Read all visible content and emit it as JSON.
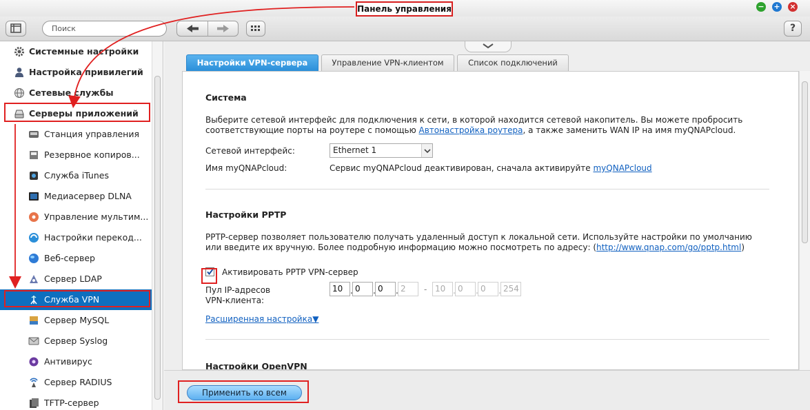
{
  "window": {
    "title_callout": "Панель управления",
    "colors": {
      "minimize": "#2ea22e",
      "maximize": "#1f78d1",
      "close": "#d23030",
      "accent": "#2b8fd9",
      "annotation": "#e02020"
    }
  },
  "toolbar": {
    "search_placeholder": "Поиск",
    "help_label": "?"
  },
  "sidebar": {
    "categories": [
      {
        "label": "Системные настройки",
        "icon": "gear-icon"
      },
      {
        "label": "Настройка привилегий",
        "icon": "user-icon"
      },
      {
        "label": "Сетевые службы",
        "icon": "globe-icon"
      },
      {
        "label": "Серверы приложений",
        "icon": "drive-icon"
      }
    ],
    "items": [
      {
        "label": "Станция управления",
        "icon": "station-icon"
      },
      {
        "label": "Резервное копиров...",
        "icon": "backup-icon"
      },
      {
        "label": "Служба iTunes",
        "icon": "itunes-icon"
      },
      {
        "label": "Медиасервер DLNA",
        "icon": "dlna-icon"
      },
      {
        "label": "Управление мультим...",
        "icon": "multimedia-icon"
      },
      {
        "label": "Настройки перекод...",
        "icon": "transcode-icon"
      },
      {
        "label": "Веб-сервер",
        "icon": "web-icon"
      },
      {
        "label": "Сервер LDAP",
        "icon": "ldap-icon"
      },
      {
        "label": "Служба VPN",
        "icon": "vpn-icon",
        "selected": true
      },
      {
        "label": "Сервер MySQL",
        "icon": "mysql-icon"
      },
      {
        "label": "Сервер Syslog",
        "icon": "syslog-icon"
      },
      {
        "label": "Антивирус",
        "icon": "antivirus-icon"
      },
      {
        "label": "Сервер RADIUS",
        "icon": "radius-icon"
      },
      {
        "label": "TFTP-сервер",
        "icon": "tftp-icon"
      }
    ]
  },
  "tabs": [
    {
      "label": "Настройки VPN-сервера",
      "active": true
    },
    {
      "label": "Управление VPN-клиентом",
      "active": false
    },
    {
      "label": "Список подключений",
      "active": false
    }
  ],
  "system": {
    "heading": "Система",
    "desc_1": "Выберите сетевой интерфейс для подключения к сети, в которой находится сетевой накопитель. Вы можете пробросить",
    "desc_2a": "соответствующие порты на роутере с помощью ",
    "desc_2_link": "Автонастройка роутера",
    "desc_2b": ", а также заменить WAN IP на имя myQNAPcloud.",
    "interface_label": "Сетевой интерфейс:",
    "interface_value": "Ethernet 1",
    "cloud_label": "Имя myQNAPcloud:",
    "cloud_text": "Сервис myQNAPcloud деактивирован, сначала активируйте ",
    "cloud_link": "myQNAPcloud"
  },
  "pptp": {
    "heading": "Настройки PPTP",
    "desc_1": "PPTP-сервер позволяет пользователю получать удаленный доступ к локальной сети. Используйте настройки по умолчанию",
    "desc_2a": "или введите их вручную. Более подробную информацию можно посмотреть по адресу: (",
    "desc_2_link": "http://www.qnap.com/go/pptp.html",
    "desc_2b": ")",
    "enable_label": "Активировать PPTP VPN-сервер",
    "pool_label_1": "Пул IP-адресов",
    "pool_label_2": "VPN-клиента:",
    "ip_start": [
      "10",
      "0",
      "0",
      "2"
    ],
    "ip_dash": "-",
    "ip_end": [
      "10",
      "0",
      "0",
      "254"
    ],
    "advanced_link": "Расширенная настройка▼"
  },
  "openvpn": {
    "heading": "Настройки OpenVPN"
  },
  "footer": {
    "apply_label": "Применить ко всем"
  }
}
